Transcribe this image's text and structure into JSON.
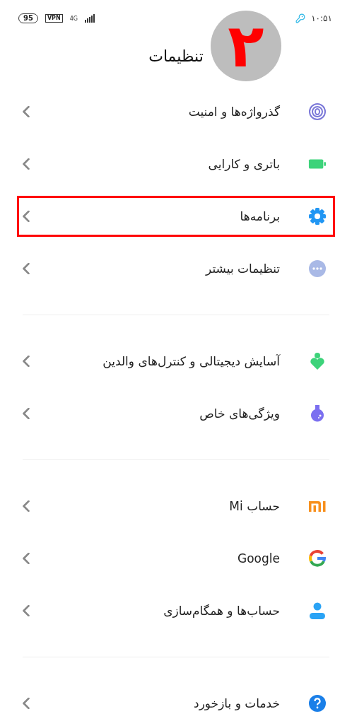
{
  "status_bar": {
    "battery": "95",
    "vpn": "VPN",
    "network": "4G",
    "time": "۱۰:۵۱"
  },
  "header": {
    "title": "تنظیمات",
    "step_badge": "۲"
  },
  "groups": [
    {
      "items": [
        {
          "label": "گذرواژه‌ها و امنیت",
          "kind": "fingerprint",
          "highlighted": false
        },
        {
          "label": "باتری و کارایی",
          "kind": "battery",
          "highlighted": false
        },
        {
          "label": "برنامه‌ها",
          "kind": "gear",
          "highlighted": true
        },
        {
          "label": "تنظیمات بیشتر",
          "kind": "more",
          "highlighted": false
        }
      ]
    },
    {
      "items": [
        {
          "label": "آسایش دیجیتالی و کنترل‌های والدین",
          "kind": "wellbeing",
          "highlighted": false
        },
        {
          "label": "ویژگی‌های خاص",
          "kind": "flask",
          "highlighted": false
        }
      ]
    },
    {
      "items": [
        {
          "label": "حساب Mi",
          "kind": "mi",
          "highlighted": false
        },
        {
          "label": "Google",
          "kind": "google",
          "highlighted": false
        },
        {
          "label": "حساب‌ها و همگام‌سازی",
          "kind": "person",
          "highlighted": false
        }
      ]
    },
    {
      "items": [
        {
          "label": "خدمات و بازخورد",
          "kind": "help",
          "highlighted": false
        }
      ]
    }
  ]
}
